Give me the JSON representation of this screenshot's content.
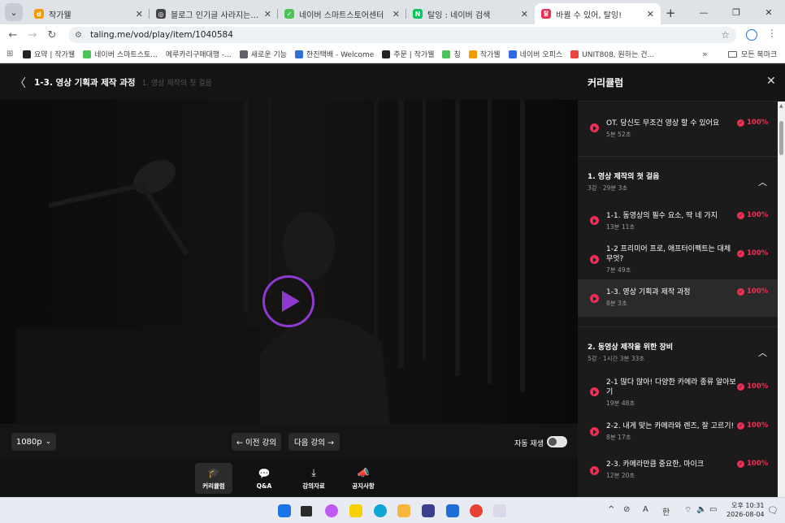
{
  "browser": {
    "tabs": [
      {
        "title": "작가웰",
        "fav_color": "#f29b05",
        "fav_glyph": "d"
      },
      {
        "title": "블로그 인기글 사라지는 이유",
        "fav_color": "#444444",
        "fav_glyph": "◎"
      },
      {
        "title": "네이버 스마트스토어센터",
        "fav_color": "#4ec25b",
        "fav_glyph": "✓"
      },
      {
        "title": "탈잉 : 네이버 검색",
        "fav_color": "#03c75a",
        "fav_glyph": "N"
      },
      {
        "title": "바뀔 수 있어, 탈잉!",
        "fav_color": "#ef2e55",
        "fav_glyph": "탈"
      }
    ],
    "url": "taling.me/vod/play/item/1040584",
    "bookmarks": [
      {
        "label": "요약 | 작가웰",
        "color": "#222222"
      },
      {
        "label": "네이버 스마트스토...",
        "color": "#4ec25b"
      },
      {
        "label": "메루카리구매대행 -...",
        "color": "#ffffff"
      },
      {
        "label": "새로운 기능",
        "color": "#5f6368"
      },
      {
        "label": "한진택배 - Welcome",
        "color": "#2f6fd6"
      },
      {
        "label": "주문 | 작가웰",
        "color": "#222222"
      },
      {
        "label": "칭",
        "color": "#4ec25b"
      },
      {
        "label": "작가웰",
        "color": "#f29b05"
      },
      {
        "label": "네이버 오피스",
        "color": "#2b6be4"
      },
      {
        "label": "UNIT808, 원하는 건...",
        "color": "#e8453c"
      }
    ],
    "all_bookmarks": "모든 북마크"
  },
  "player": {
    "title": "1-3. 영상 기획과 제작 과정",
    "section": "1. 영상 제작의 첫 걸음",
    "quality": "1080p",
    "prev": "← 이전 강의",
    "next": "다음 강의 →",
    "autoplay_label": "자동 재생",
    "autoplay_on": false,
    "tabs": [
      {
        "label": "커리큘럼",
        "icon": "graduation-cap-icon",
        "glyph": "🎓"
      },
      {
        "label": "Q&A",
        "icon": "chat-bubble-icon",
        "glyph": "💬"
      },
      {
        "label": "강의자료",
        "icon": "download-icon",
        "glyph": "⤓"
      },
      {
        "label": "공지사항",
        "icon": "megaphone-icon",
        "glyph": "📣"
      }
    ]
  },
  "curriculum": {
    "title": "커리큘럼",
    "intro": {
      "title": "OT. 당신도 무조건 영상 할 수 있어요",
      "duration": "5분 52초",
      "progress": "100%"
    },
    "sections": [
      {
        "title": "1. 영상 제작의 첫 걸음",
        "meta": "3강 · 29분 3초",
        "lessons": [
          {
            "title": "1-1. 동영상의 필수 요소, 딱 네 가지",
            "duration": "13분 11초",
            "progress": "100%"
          },
          {
            "title": "1-2 프리미어 프로, 애프터이펙트는 대체 무엇?",
            "duration": "7분 49초",
            "progress": "100%"
          },
          {
            "title": "1-3. 영상 기획과 제작 과정",
            "duration": "8분 3초",
            "progress": "100%"
          }
        ]
      },
      {
        "title": "2. 동영상 제작을 위한 장비",
        "meta": "5강 · 1시간 3분 33초",
        "lessons": [
          {
            "title": "2-1 많다 많아! 다양한 카메라 종류 알아보기",
            "duration": "19분 48초",
            "progress": "100%"
          },
          {
            "title": "2-2. 내게 맞는 카메라와 렌즈, 잘 고르기!",
            "duration": "8분 17초",
            "progress": "100%"
          },
          {
            "title": "2-3. 카메라만큼 중요한, 마이크",
            "duration": "12분 20초",
            "progress": "100%"
          }
        ]
      }
    ]
  },
  "taskbar": {
    "ampm_time": "오후 10:31",
    "date": "2026-08-04",
    "ime": "A",
    "lang": "한"
  }
}
